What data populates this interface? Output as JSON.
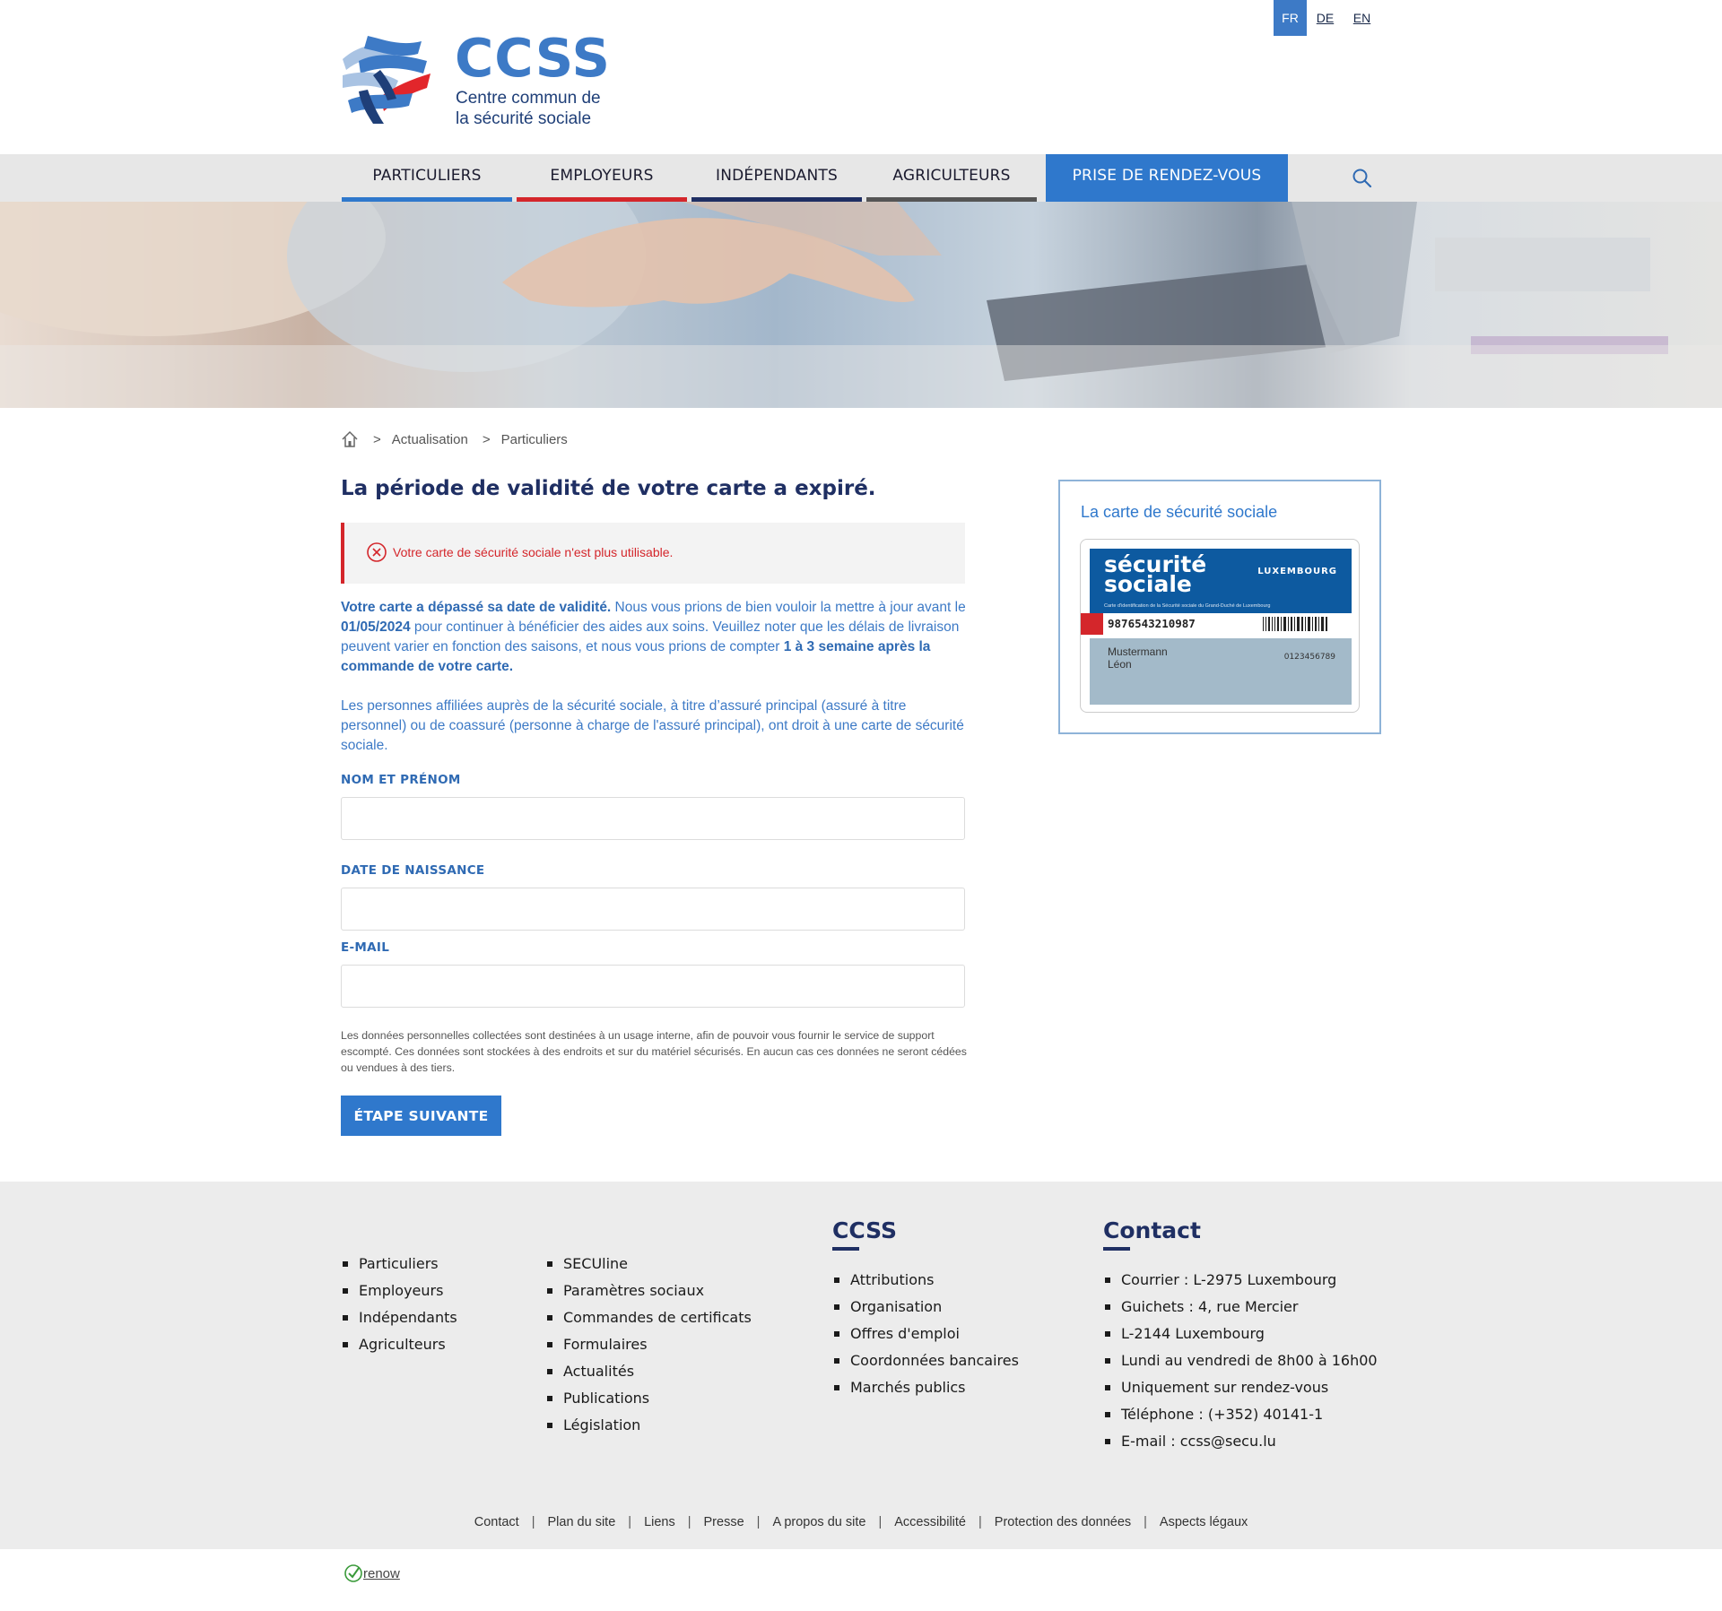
{
  "brand": {
    "name": "CCSS",
    "subtitle_line1": "Centre commun de",
    "subtitle_line2": "la sécurité sociale",
    "colors": {
      "primary_blue": "#3d7ac6",
      "navy": "#1f2f63",
      "red": "#d4262b"
    }
  },
  "languages": [
    "FR",
    "DE",
    "EN"
  ],
  "active_language": "FR",
  "nav": {
    "items": [
      {
        "label": "PARTICULIERS",
        "color": "#2f78cc"
      },
      {
        "label": "EMPLOYEURS",
        "color": "#d4262b"
      },
      {
        "label": "INDÉPENDANTS",
        "color": "#1f2f63"
      },
      {
        "label": "AGRICULTEURS",
        "color": "#555555"
      }
    ],
    "cta": "PRISE DE RENDEZ-VOUS",
    "search_icon": "search-icon"
  },
  "breadcrumb": {
    "home_icon": "home-icon",
    "items": [
      "Actualisation",
      "Particuliers"
    ],
    "separator": ">"
  },
  "main": {
    "title": "La période de validité de votre carte a expiré.",
    "alert": "Votre carte de sécurité sociale n'est plus utilisable.",
    "p1_bold1": "Votre carte a dépassé sa date de validité.",
    "p1_text1": " Nous vous prions de bien vouloir la mettre à jour avant le ",
    "p1_date": "01/05/2024",
    "p1_text2": " pour continuer à bénéficier des aides aux soins. Veuillez noter que les délais de livraison peuvent varier en fonction des saisons, et nous vous prions de compter ",
    "p1_bold2": "1 à 3 semaine après la commande de votre carte.",
    "p2": "Les personnes affiliées auprès de la sécurité sociale, à titre d’assuré principal (assuré à titre personnel) ou de coassuré (personne à charge de l'assuré principal), ont droit à une carte de sécurité sociale.",
    "fields": {
      "name_label": "NOM ET PRÉNOM",
      "name_value": "",
      "dob_label": "DATE DE NAISSANCE",
      "dob_value": "",
      "email_label": "E-MAIL",
      "email_value": ""
    },
    "disclaimer": "Les données personnelles collectées sont destinées à un usage interne, afin de pouvoir vous fournir le service de support escompté. Ces données sont stockées à des endroits et sur du matériel sécurisés. En aucun cas ces données ne seront cédées ou vendues à des tiers.",
    "next_button": "ÉTAPE SUIVANTE"
  },
  "side_card": {
    "title": "La carte de sécurité sociale",
    "card_title_line1": "sécurité",
    "card_title_line2": "sociale",
    "card_country": "LUXEMBOURG",
    "card_small": "Carte d'identification de la Sécurité sociale du Grand-Duché de Luxembourg",
    "card_number": "9876543210987",
    "card_lastname": "Mustermann",
    "card_firstname": "Léon",
    "card_id": "0123456789"
  },
  "footer": {
    "col1": [
      "Particuliers",
      "Employeurs",
      "Indépendants",
      "Agriculteurs"
    ],
    "col2": [
      "SECUline",
      "Paramètres sociaux",
      "Commandes de certificats",
      "Formulaires",
      "Actualités",
      "Publications",
      "Législation"
    ],
    "col3_title": "CCSS",
    "col3": [
      "Attributions",
      "Organisation",
      "Offres d'emploi",
      "Coordonnées bancaires",
      "Marchés publics"
    ],
    "col4_title": "Contact",
    "col4": [
      "Courrier : L-2975 Luxembourg",
      "Guichets : 4, rue Mercier",
      "L-2144 Luxembourg",
      "Lundi au vendredi de 8h00 à 16h00",
      "Uniquement sur rendez-vous",
      "Téléphone : (+352) 40141-1",
      "E-mail : ccss@secu.lu"
    ],
    "links": [
      "Contact",
      "Plan du site",
      "Liens",
      "Presse",
      "A propos du site",
      "Accessibilité",
      "Protection des données",
      "Aspects légaux"
    ],
    "renow": "renow"
  }
}
